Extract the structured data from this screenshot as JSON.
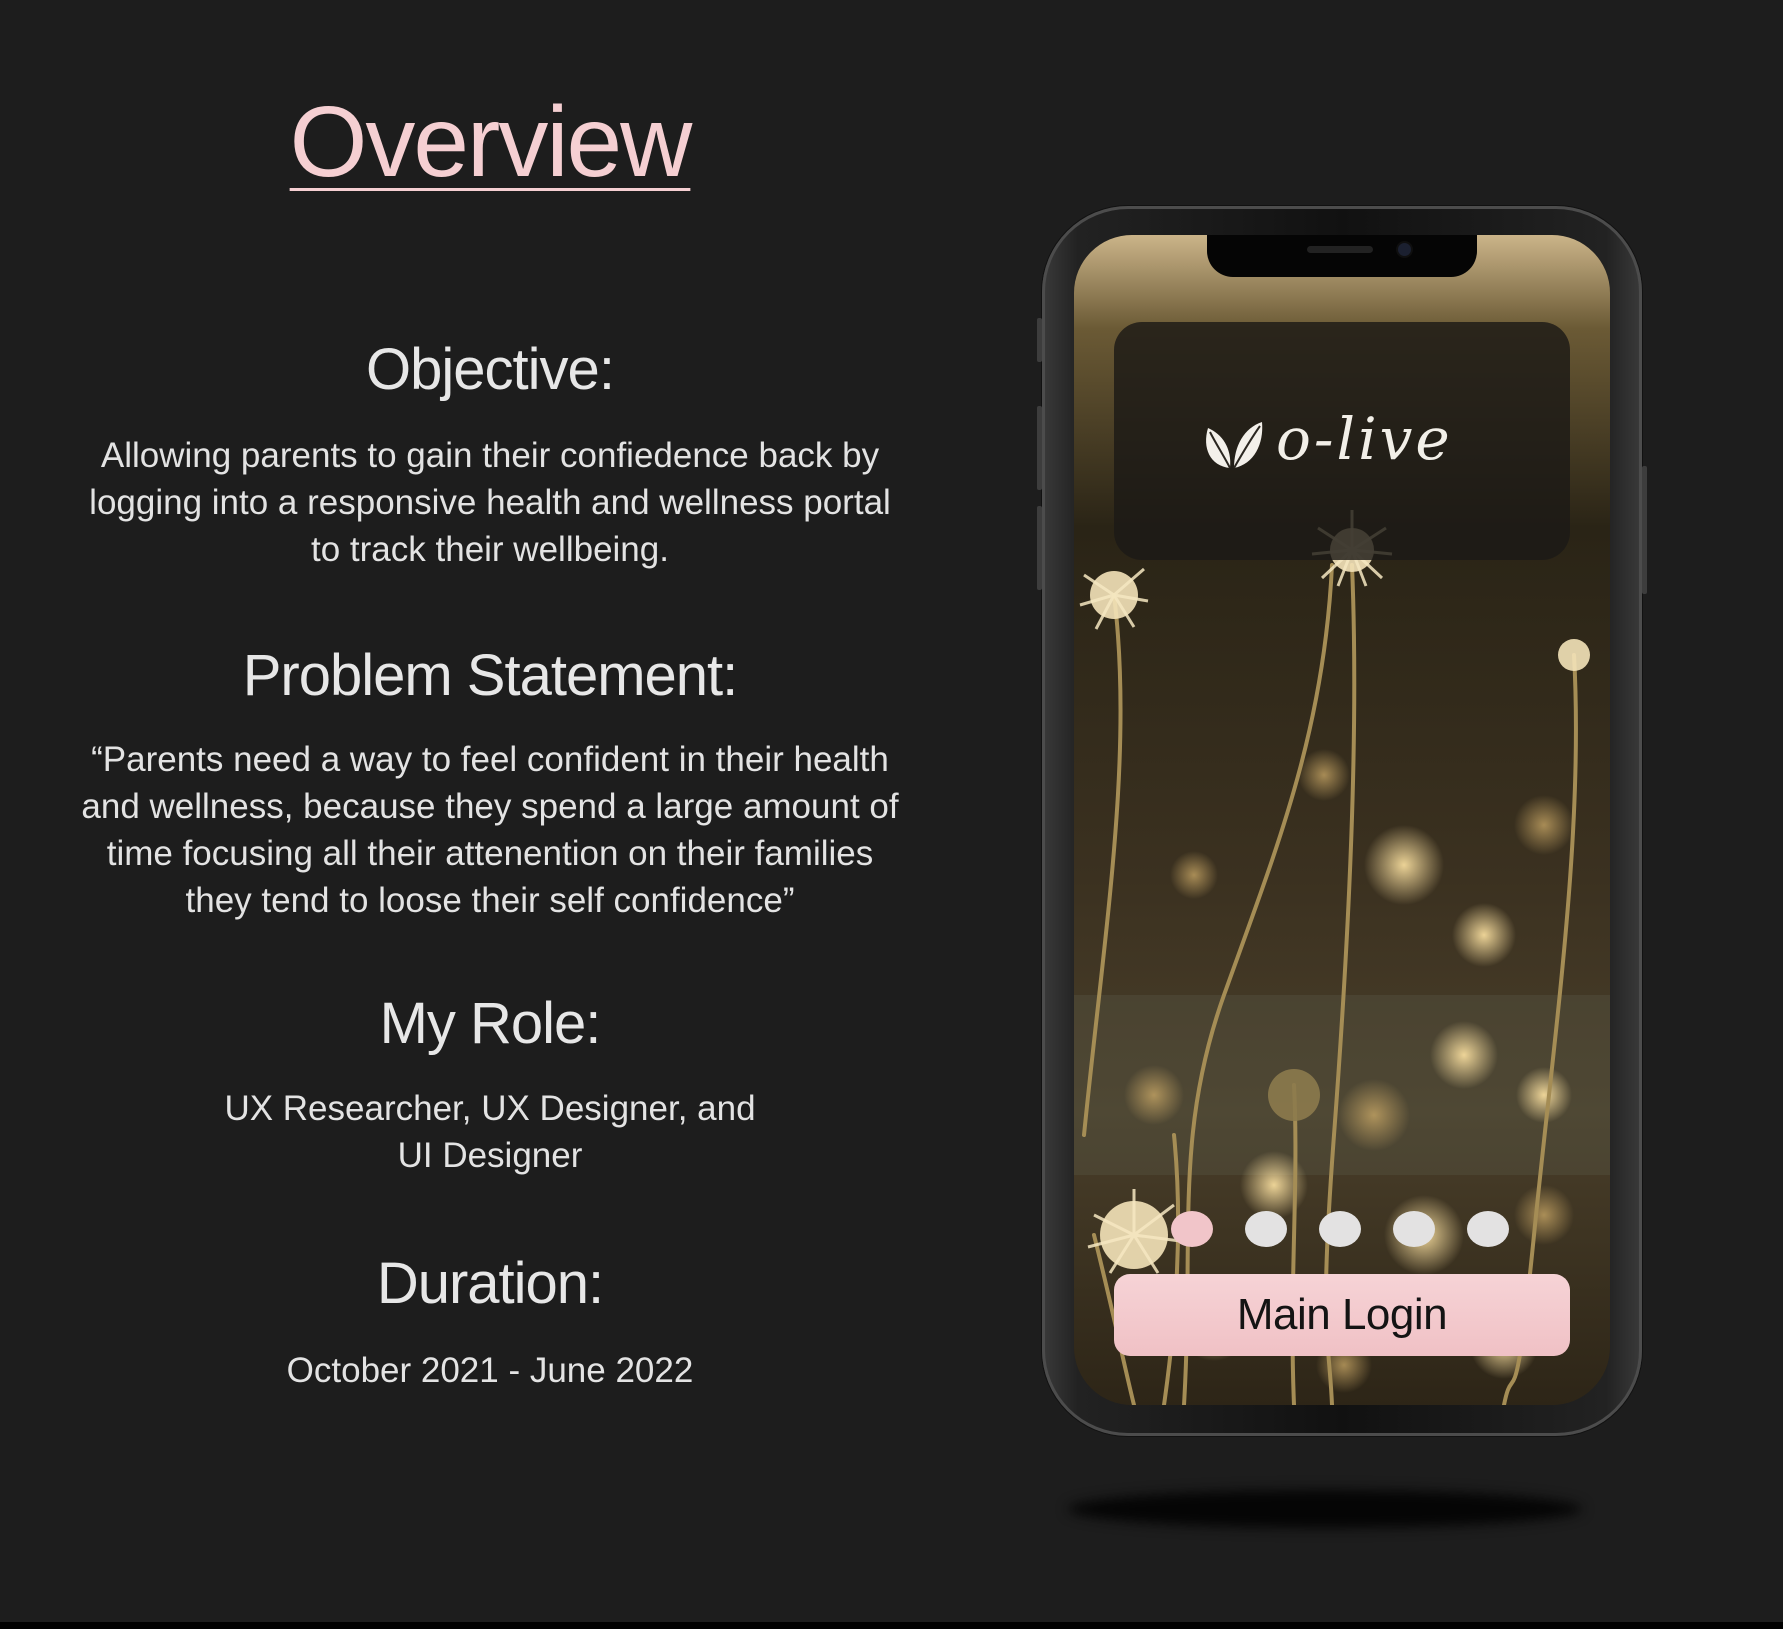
{
  "overview": {
    "title": "Overview"
  },
  "sections": {
    "objective": {
      "heading": "Objective:",
      "lines": [
        "Allowing parents to gain their confiedence back by",
        "logging into a responsive health and wellness portal",
        "to track their wellbeing."
      ]
    },
    "problem": {
      "heading": "Problem Statement:",
      "lines": [
        "“Parents need a way to feel confident in their health",
        "and wellness, because they spend a large amount of",
        "time focusing all their attenention on their families",
        "they tend to loose their self confidence”"
      ]
    },
    "role": {
      "heading": "My Role:",
      "lines": [
        "UX Researcher, UX Designer, and",
        "UI Designer"
      ]
    },
    "duration": {
      "heading": "Duration:",
      "lines": [
        "October 2021 - June 2022"
      ]
    }
  },
  "phone": {
    "logo_text": "o-live",
    "logo_icon": "leaf-icon",
    "login_label": "Main Login",
    "carousel": {
      "count": 5,
      "active_index": 0
    }
  },
  "colors": {
    "background": "#1d1d1d",
    "accent_pink": "#f5cfd2",
    "button_pink": "#f1c5c9",
    "text": "#e9e9e9"
  }
}
